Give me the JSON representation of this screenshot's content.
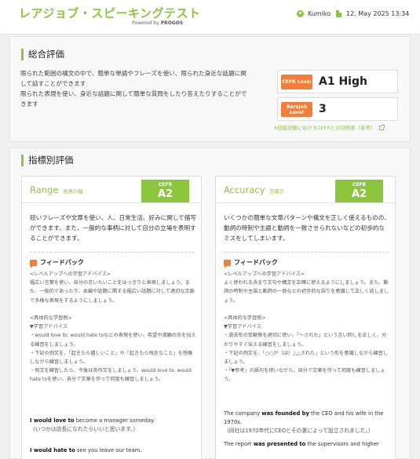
{
  "header": {
    "brand": "レアジョブ・スピーキングテスト",
    "powered_by_prefix": "Powered by",
    "powered_by_name": "PROGOS",
    "user_name": "Kumiko",
    "date": "12, May 2025 13:34"
  },
  "summary": {
    "title": "総合評価",
    "text_lines": [
      "限られた範囲の構文の中で、簡単な単語やフレーズを使い、限られた身近な話題に関",
      "して話すことができます",
      "限られた表現を使い、身近な話題に関して簡単な質問をしたり答えたりすることがで",
      "きます"
    ],
    "cefr_label_1": "CEFR Level",
    "cefr_value": "A1 High",
    "rarejob_label_1": "RareJob",
    "rarejob_label_2": "Level",
    "rarejob_value": "3",
    "chart_link": "4技能試験におけるCEFRとの対照表（参考）"
  },
  "indicators": {
    "title": "指標別評価",
    "cefr_tag_label": "CEFR",
    "feedback_title": "フィードバック",
    "cards": [
      {
        "name": "Range",
        "sub": "表現の幅",
        "cefr": "A2",
        "desc": "短いフレーズや文章を使い、人、日常生活、好みに関して描写ができます。また、一般的な事柄に対して自分の立場を表明することができます。",
        "feedback": [
          "<レベルアップへの学習アドバイス>",
          "幅広い言葉を使い、自分の言いたいことをはっきりと表現しましょう。また、一般的であったり、本編や話題に関する幅広い話題に対して適切な文脈で多様な表現をするようにしましょう。",
          "",
          "<具体的な学習例>",
          "▼学習アドバイス",
          "・would love to, would hate toなどの表現を使い、希望や満願の念を伝える練習をしましょう。",
          "・下記の例文を、「起きたら嬉しいこと」や「起きたら残念なこと」を想像しながら練習しましょう。",
          "・例文を練習したら、今後は英作文をしましょう。would love to, would hate toを使い、自分で文章を作って何度も練習しましょう。"
        ],
        "examples": [
          {
            "pre": "",
            "b1": "I would love to",
            "post": " become a manager someday.",
            "ja": "（いつかは店長になれたらいいと思います。）"
          },
          {
            "pre": "",
            "b1": "I would hate to",
            "post": " see you leave our team.",
            "ja": ""
          }
        ]
      },
      {
        "name": "Accuracy",
        "sub": "正確さ",
        "cefr": "A2",
        "desc": "いくつかの簡単な文章パターンや構文を正しく使えるものの、動詞の時制や主語と動詞を一致させられないなどの初歩的なミスをしてしまいます。",
        "feedback": [
          "<レベルアップへの学習アドバイス>",
          "よく使われる決まり文句や構文を正確に使えるようにしましょう。また、動詞の時制や主語と動詞の一致などの初歩的な誤りを意識して正しく話しましょう。",
          "",
          "<具体的な学習例>",
          "▼学習アドバイス",
          "・過去形の受動態を適切に使い、「〜された」という言い回しを正しく、分かりやすく伝える練習をしましょう。",
          "・下記の例文を、「○○が（は）△△された」という形を意識しながら練習しましょう。",
          "・「▼参考」の語句を使いながら、自分で文章を作って何度も練習しましょう。"
        ],
        "examples": [
          {
            "pre": "The company ",
            "b1": "was founded by",
            "post": " the CEO and his wife in the 1970s.",
            "ja": "（同社は1970年代にCEOとその妻によって設立されました。）"
          },
          {
            "pre": "The report ",
            "b1": "was presented to",
            "post": " the supervisors and higher",
            "ja": ""
          }
        ]
      }
    ]
  }
}
